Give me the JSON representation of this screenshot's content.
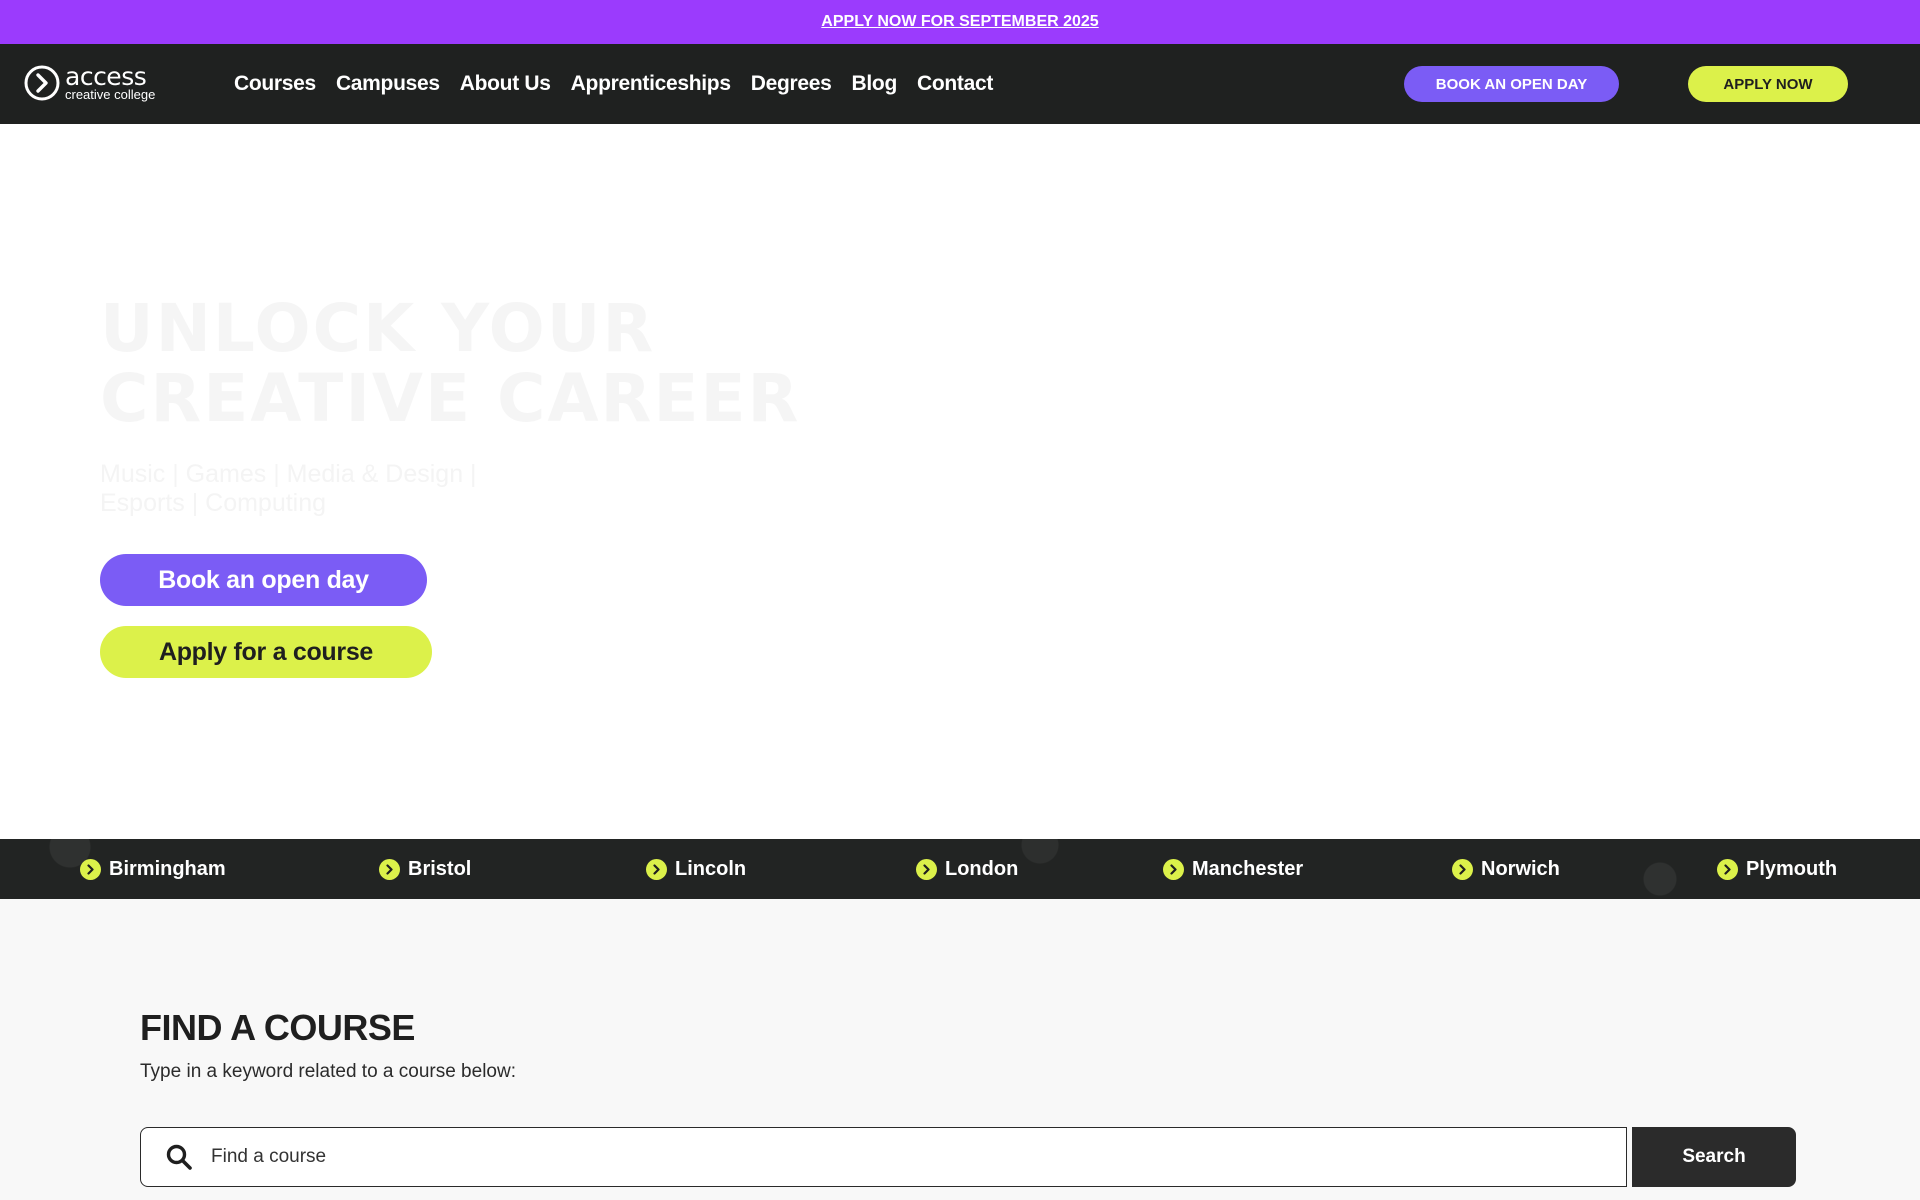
{
  "promo": {
    "text": "APPLY NOW FOR SEPTEMBER 2025"
  },
  "header": {
    "logo": {
      "word": "access",
      "sub": "creative college"
    },
    "nav": [
      "Courses",
      "Campuses",
      "About Us",
      "Apprenticeships",
      "Degrees",
      "Blog",
      "Contact"
    ],
    "open_day_label": "BOOK AN OPEN DAY",
    "apply_label": "APPLY NOW"
  },
  "hero": {
    "title_line1": "UNLOCK YOUR",
    "title_line2": "CREATIVE CAREER",
    "subtitle": "Music | Games | Media & Design | Esports | Computing",
    "open_day_button": "Book an open day",
    "apply_button": "Apply for a course"
  },
  "campuses": [
    "Birmingham",
    "Bristol",
    "Lincoln",
    "London",
    "Manchester",
    "Norwich",
    "Plymouth"
  ],
  "find_course": {
    "title": "FIND A COURSE",
    "description": "Type in a keyword related to a course below:",
    "search_placeholder": "Find a course",
    "search_button": "Search"
  },
  "colors": {
    "promo_bg": "#9b3bfd",
    "nav_bg": "#1f2120",
    "purple": "#7b5cf5",
    "lime": "#dcf14a",
    "dark": "#2b2b2b"
  },
  "icons": {
    "logo": "circle-chevron-right-icon",
    "campus": "chevron-right-circle-icon",
    "search": "search-icon"
  }
}
